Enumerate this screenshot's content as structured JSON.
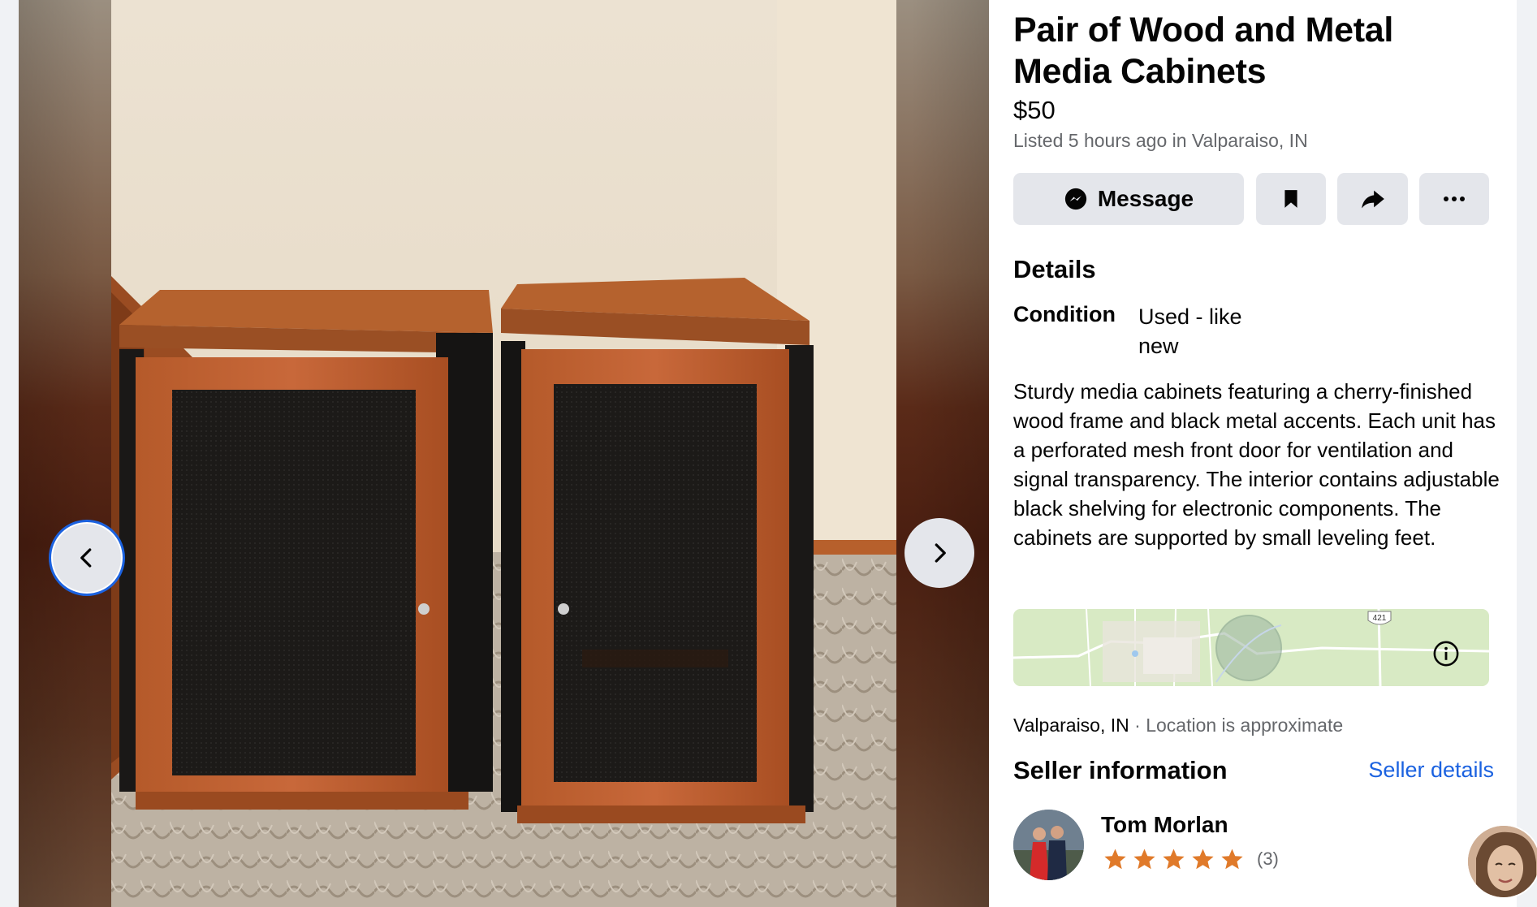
{
  "listing": {
    "title": "Pair of Wood and Metal Media Cabinets",
    "price": "$50",
    "listed": "Listed 5 hours ago in Valparaiso, IN"
  },
  "actions": {
    "message_label": "Message",
    "save_icon": "bookmark-icon",
    "share_icon": "share-icon",
    "more_icon": "more-icon"
  },
  "details": {
    "heading": "Details",
    "condition_label": "Condition",
    "condition_value": "Used - like new",
    "description": "Sturdy media cabinets featuring a cherry-finished wood frame and black metal accents. Each unit has a perforated mesh front door for ventilation and signal transparency. The interior contains adjustable black shelving for electronic components. The cabinets are supported by small leveling feet."
  },
  "map": {
    "route_shield": "421",
    "location_name": "Valparaiso, IN",
    "location_note": " · Location is approximate"
  },
  "seller": {
    "heading": "Seller information",
    "details_link": "Seller details",
    "name": "Tom Morlan",
    "rating_stars": 5,
    "rating_count": "(3)"
  },
  "colors": {
    "accent": "#1b62e0",
    "star": "#e07a2a",
    "button_bg": "#e4e6eb",
    "muted_text": "#65676b"
  }
}
